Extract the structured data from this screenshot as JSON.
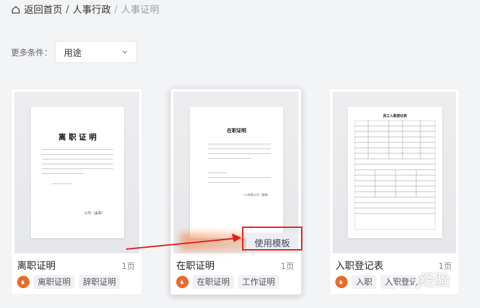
{
  "breadcrumb": {
    "home_label": "返回首页",
    "sep": "/",
    "level1": "人事行政",
    "current": "人事证明"
  },
  "filter": {
    "label": "更多条件：",
    "select_value": "用途"
  },
  "cards": [
    {
      "title": "离职证明",
      "pages": "1页",
      "tags": [
        "离职证明",
        "辞职证明"
      ],
      "doc_heading": "离 职 证 明",
      "doc_sign": "公司（盖章）"
    },
    {
      "title": "在职证明",
      "pages": "1页",
      "tags": [
        "在职证明",
        "工作证明"
      ],
      "doc_heading": "在职证明",
      "doc_sign": "××有限公司（盖章）",
      "action_label": "使用模板"
    },
    {
      "title": "入职登记表",
      "pages": "1页",
      "tags": [
        "入职",
        "入职登记"
      ],
      "doc_heading": "员工入职登记表"
    }
  ],
  "colors": {
    "badge": "#e96b2b",
    "annotation": "#e02020",
    "background": "#f3f4f6"
  },
  "watermark": {
    "text": "经验"
  }
}
